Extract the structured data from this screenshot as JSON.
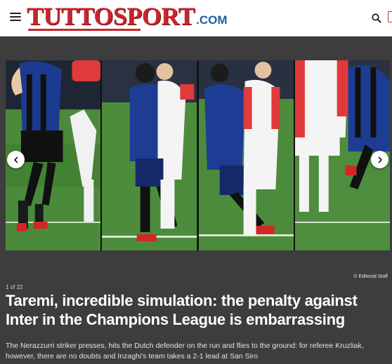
{
  "header": {
    "logo": {
      "main": "TUTTOSPORT",
      "suffix": ".COM"
    },
    "menu_icon": "hamburger-menu-icon",
    "search_icon": "search-icon"
  },
  "gallery": {
    "credit": "© Editorial Staff",
    "counter": "1 of 22",
    "prev_icon": "chevron-left-icon",
    "next_icon": "chevron-right-icon"
  },
  "article": {
    "title": "Taremi, incredible simulation: the penalty against Inter in the Champions League is embarrassing",
    "summary": "The Nerazzurri striker presses, hits the Dutch defender on the run and flies to the ground: for referee Kruzliak, however, there are no doubts and Inzaghi's team takes a 2-1 lead at San Siro"
  },
  "colors": {
    "brand_red": "#c8252c",
    "brand_blue": "#1e5fa8",
    "page_background": "#3d3d3d",
    "pitch_green": "#4a8a3a"
  }
}
